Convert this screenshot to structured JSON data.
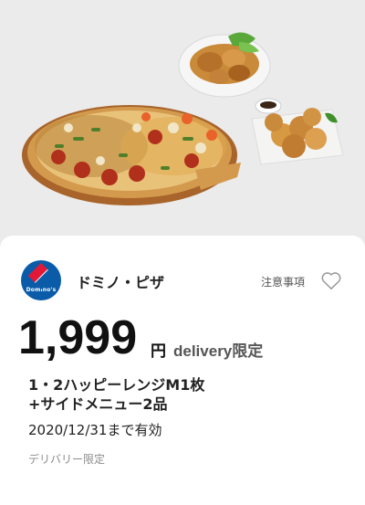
{
  "coupon": {
    "brand_name": "ドミノ・ピザ",
    "logo_text": "Domino's",
    "notice_link": "注意事項",
    "price": "1,999",
    "price_unit": "円",
    "delivery_prefix": "delivery",
    "delivery_suffix": "限定",
    "item_line1": "1・2ハッピーレンジM1枚",
    "item_line2": "+サイドメニュー2品",
    "expiry": "2020/12/31まで有効",
    "restriction_note": "デリバリー限定"
  },
  "icons": {
    "favorite": "heart-outline-icon",
    "logo": "dominos-logo"
  },
  "colors": {
    "brand_blue": "#0b5ca8",
    "brand_red": "#e31837",
    "card_background": "#ffffff",
    "photo_background": "#ebebeb"
  }
}
